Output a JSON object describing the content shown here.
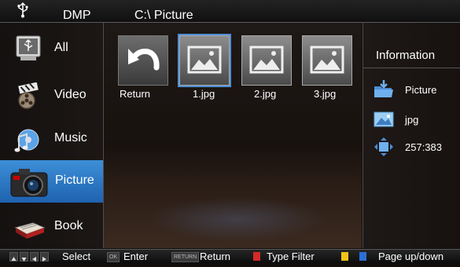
{
  "header": {
    "app_title": "DMP",
    "path": "C:\\ Picture",
    "icon": "usb-icon"
  },
  "sidebar": {
    "items": [
      {
        "label": "All",
        "icon": "usb-drive-icon",
        "selected": false
      },
      {
        "label": "Video",
        "icon": "film-reel-icon",
        "selected": false
      },
      {
        "label": "Music",
        "icon": "music-note-icon",
        "selected": false
      },
      {
        "label": "Picture",
        "icon": "camera-icon",
        "selected": true
      },
      {
        "label": "Book",
        "icon": "book-icon",
        "selected": false
      }
    ]
  },
  "browser": {
    "items": [
      {
        "label": "Return",
        "icon": "return-arrow-icon"
      },
      {
        "label": "1.jpg",
        "icon": "image-thumbnail-icon",
        "selected": true
      },
      {
        "label": "2.jpg",
        "icon": "image-thumbnail-icon"
      },
      {
        "label": "3.jpg",
        "icon": "image-thumbnail-icon"
      }
    ]
  },
  "info": {
    "title": "Information",
    "folder": "Picture",
    "type": "jpg",
    "resolution": "257:383"
  },
  "footer": {
    "select": "Select",
    "ok_key": "OK",
    "enter": "Enter",
    "return_key": "RETURN",
    "return": "Return",
    "type_filter": "Type Filter",
    "page": "Page up/down"
  },
  "colors": {
    "selection": "#2f7dd0",
    "red_key": "#d42a2a",
    "yellow_key": "#f2c21b",
    "blue_key": "#2a6fd6"
  }
}
